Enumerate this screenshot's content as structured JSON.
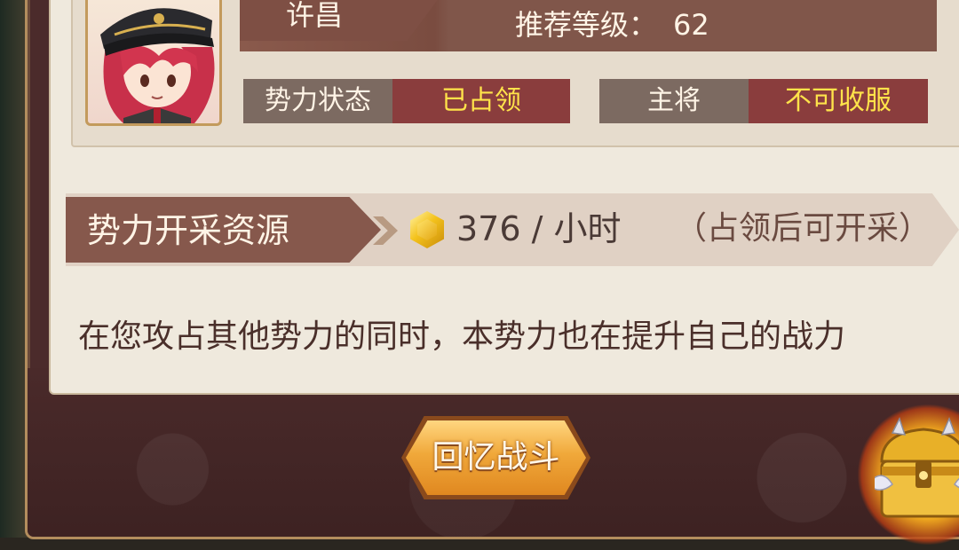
{
  "stronghold": {
    "name": "许昌",
    "recommended_level_label": "推荐等级：",
    "recommended_level": "62"
  },
  "status": {
    "power_state_label": "势力状态",
    "power_state_value": "已占领",
    "general_label": "主将",
    "general_value": "不可收服"
  },
  "resources": {
    "label": "势力开采资源",
    "rate": "376 / 小时",
    "note": "（占领后可开采）",
    "icon": "gold-coin-icon"
  },
  "description": "在您攻占其他势力的同时，本势力也在提升自己的战力",
  "buttons": {
    "recall_battle": "回忆战斗"
  },
  "colors": {
    "value_yellow": "#ffe34a",
    "value_bg_red": "#8a3d3d",
    "label_bg": "#7c6a61",
    "panel_bg": "#efe9dd"
  }
}
